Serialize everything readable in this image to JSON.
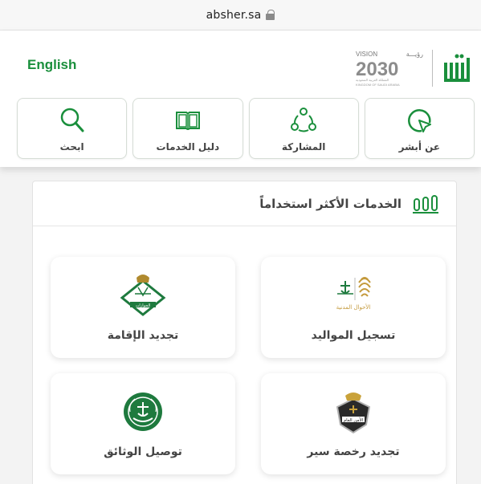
{
  "browser": {
    "url": "absher.sa"
  },
  "header": {
    "language_link": "English",
    "vision_text": "VISION",
    "vision_year": "2030",
    "vision_arabic": "رؤيـــة",
    "vision_kingdom": "KINGDOM OF SAUDI ARABIA",
    "vision_kingdom_ar": "المملكة العربية السعودية",
    "brand_color": "#1a8f3c"
  },
  "nav": [
    {
      "label": "ابحث",
      "icon": "search-icon"
    },
    {
      "label": "دليل الخدمات",
      "icon": "book-icon"
    },
    {
      "label": "المشاركة",
      "icon": "share-icon"
    },
    {
      "label": "عن أبشر",
      "icon": "pointer-icon"
    }
  ],
  "most_used": {
    "title": "الخدمات الأكثر استخداماً",
    "icon": "bars-icon",
    "services": [
      {
        "label": "تجديد الإقامة",
        "icon": "passports-emblem-icon",
        "emblem_text": "الجوازات"
      },
      {
        "label": "تسجيل المواليد",
        "icon": "civil-affairs-icon",
        "emblem_text": "الأحوال المدنية"
      },
      {
        "label": "توصيل الوثائق",
        "icon": "interior-emblem-icon",
        "emblem_text": ""
      },
      {
        "label": "تجديد رخصة سير",
        "icon": "public-security-icon",
        "emblem_text": "الأمن العام"
      }
    ]
  }
}
